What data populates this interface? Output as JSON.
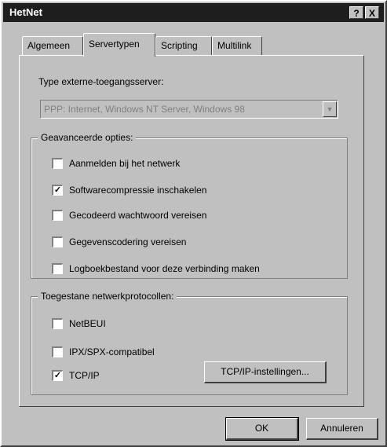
{
  "window": {
    "title": "HetNet",
    "help_label": "?",
    "close_label": "X"
  },
  "tabs": [
    {
      "label": "Algemeen"
    },
    {
      "label": "Servertypen"
    },
    {
      "label": "Scripting"
    },
    {
      "label": "Multilink"
    }
  ],
  "server_type": {
    "label": "Type externe-toegangsserver:",
    "value": "PPP: Internet, Windows NT Server, Windows 98",
    "dropdown_glyph": "▼"
  },
  "advanced": {
    "legend": "Geavanceerde opties:",
    "options": [
      {
        "label": "Aanmelden bij het netwerk",
        "checked": false
      },
      {
        "label": "Softwarecompressie inschakelen",
        "checked": true
      },
      {
        "label": "Gecodeerd wachtwoord vereisen",
        "checked": false
      },
      {
        "label": "Gegevenscodering vereisen",
        "checked": false
      },
      {
        "label": "Logboekbestand voor deze verbinding maken",
        "checked": false
      }
    ]
  },
  "protocols": {
    "legend": "Toegestane netwerkprotocollen:",
    "options": [
      {
        "label": "NetBEUI",
        "checked": false
      },
      {
        "label": "IPX/SPX-compatibel",
        "checked": false
      },
      {
        "label": "TCP/IP",
        "checked": true
      }
    ],
    "tcpip_settings_label": "TCP/IP-instellingen..."
  },
  "footer": {
    "ok_label": "OK",
    "cancel_label": "Annuleren"
  },
  "check_glyph": "✓"
}
